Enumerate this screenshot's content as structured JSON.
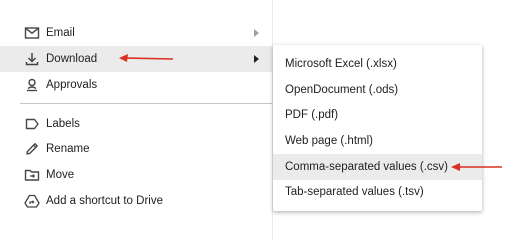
{
  "menu": {
    "items": [
      {
        "label": "Email",
        "icon": "mail-icon",
        "has_submenu": true,
        "highlighted": false
      },
      {
        "label": "Download",
        "icon": "download-icon",
        "has_submenu": true,
        "highlighted": true
      },
      {
        "label": "Approvals",
        "icon": "approvals-icon",
        "has_submenu": false,
        "highlighted": false
      },
      {
        "label": "Labels",
        "icon": "label-icon",
        "has_submenu": false,
        "highlighted": false
      },
      {
        "label": "Rename",
        "icon": "pencil-icon",
        "has_submenu": false,
        "highlighted": false
      },
      {
        "label": "Move",
        "icon": "folder-move-icon",
        "has_submenu": false,
        "highlighted": false
      },
      {
        "label": "Add a shortcut to Drive",
        "icon": "drive-shortcut-icon",
        "has_submenu": false,
        "highlighted": false
      }
    ]
  },
  "download_submenu": {
    "items": [
      {
        "label": "Microsoft Excel (.xlsx)",
        "highlighted": false
      },
      {
        "label": "OpenDocument (.ods)",
        "highlighted": false
      },
      {
        "label": "PDF (.pdf)",
        "highlighted": false
      },
      {
        "label": "Web page (.html)",
        "highlighted": false
      },
      {
        "label": "Comma-separated values (.csv)",
        "highlighted": true
      },
      {
        "label": "Tab-separated values (.tsv)",
        "highlighted": false
      }
    ]
  },
  "annotation_color": "#d93025",
  "accent_highlight": "#ebebeb"
}
